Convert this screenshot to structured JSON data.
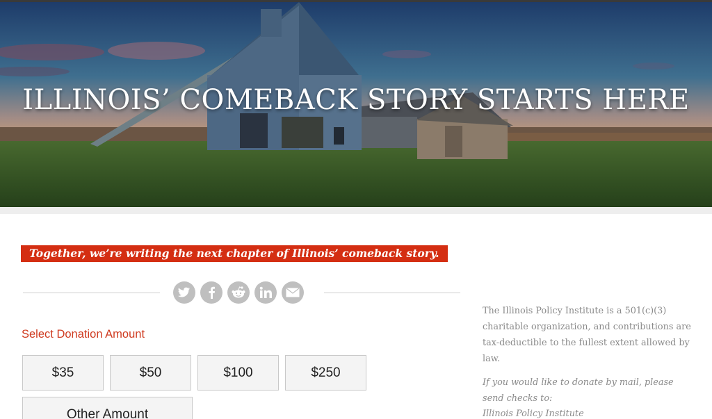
{
  "hero": {
    "title": "ILLINOIS’ COMEBACK STORY STARTS HERE"
  },
  "tagline": "Together, we’re writing the next chapter of Illinois’ comeback story.",
  "share": {
    "icons": [
      "twitter-icon",
      "facebook-icon",
      "reddit-icon",
      "linkedin-icon",
      "email-icon"
    ]
  },
  "donation": {
    "label": "Select Donation Amount",
    "amounts": [
      "$35",
      "$50",
      "$100",
      "$250"
    ],
    "other_label": "Other Amount"
  },
  "sidebar": {
    "tax_text": "The Illinois Policy Institute is a 501(c)(3) charitable organization, and contributions are tax-deductible to the fullest extent allowed by law.",
    "mail_text": "If you would like to donate by mail, please send checks to:",
    "mail_name": "Illinois Policy Institute"
  },
  "colors": {
    "accent": "#d42e12",
    "label_red": "#cf3a1f",
    "icon_grey": "#bfbfbf"
  }
}
